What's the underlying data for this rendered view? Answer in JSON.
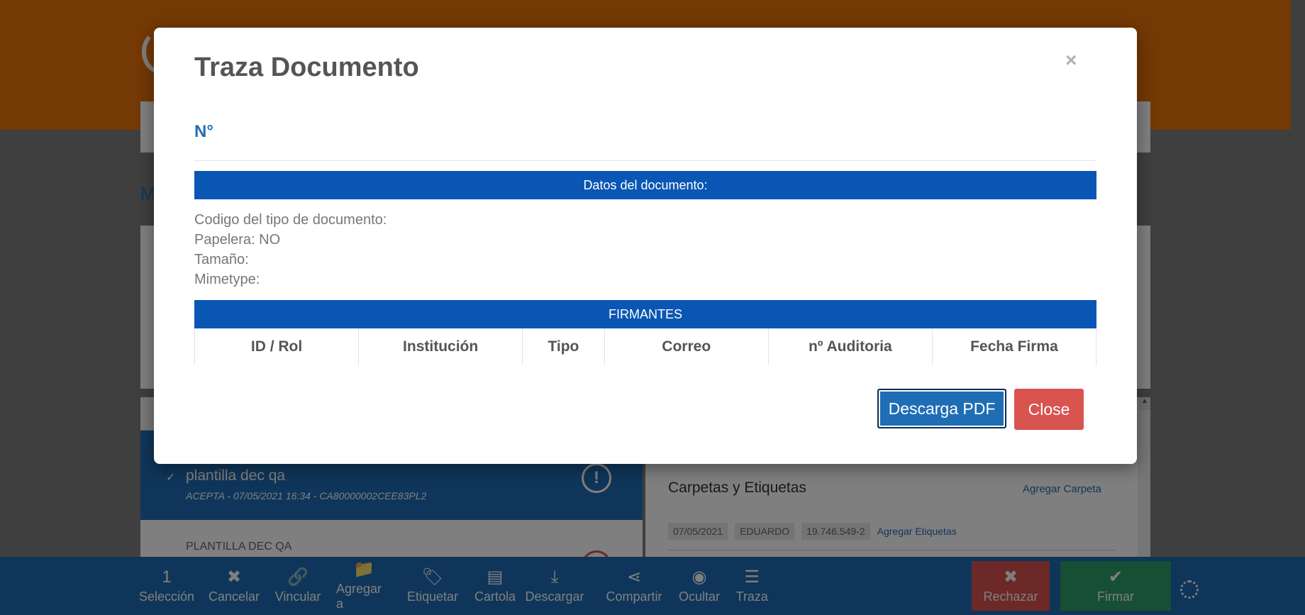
{
  "background": {
    "page_heading": "M",
    "list": {
      "active_item": {
        "check": "✓",
        "title": "plantilla dec qa",
        "subtitle": "ACEPTA - 07/05/2021 16:34 - CA80000002CEE83PL2",
        "status_icon": "!"
      },
      "second_item": {
        "title": "PLANTILLA DEC QA"
      }
    },
    "details": {
      "folders_title": "Carpetas y Etiquetas",
      "add_folder": "Agregar Carpeta",
      "tags": [
        "07/05/2021",
        "EDUARDO",
        "19.746.549-2"
      ],
      "add_tags": "Agregar Etiquetas"
    },
    "toolbar": {
      "selection_count": "1",
      "items": [
        {
          "label": "Selección",
          "icon": "count"
        },
        {
          "label": "Cancelar",
          "icon": "times-icon",
          "glyph": "✖"
        },
        {
          "label": "Vincular",
          "icon": "link-icon",
          "glyph": "🔗"
        },
        {
          "label": "Agregar a",
          "icon": "folder-icon",
          "glyph": "📁"
        },
        {
          "label": "Etiquetar",
          "icon": "tag-icon",
          "glyph": "🏷"
        },
        {
          "label": "Cartola",
          "icon": "list-alt-icon",
          "glyph": "▤"
        },
        {
          "label": "Descargar",
          "icon": "download-icon",
          "glyph": "⤓"
        },
        {
          "label": "Compartir",
          "icon": "share-icon",
          "glyph": "⋖"
        },
        {
          "label": "Ocultar",
          "icon": "eye-slash-icon",
          "glyph": "◉"
        },
        {
          "label": "Traza",
          "icon": "list-icon",
          "glyph": "☰"
        }
      ],
      "reject": {
        "label": "Rechazar",
        "glyph": "✖"
      },
      "sign": {
        "label": "Firmar",
        "glyph": "✔"
      }
    }
  },
  "modal": {
    "title": "Traza Documento",
    "close_glyph": "×",
    "number_label": "N°",
    "document_section": "Datos del documento:",
    "fields": [
      "Codigo del tipo de documento:",
      "Papelera: NO",
      "Tamaño:",
      "Mimetype:"
    ],
    "signers_section": "FIRMANTES",
    "columns": [
      "ID / Rol",
      "Institución",
      "Tipo",
      "Correo",
      "nº Auditoria",
      "Fecha Firma"
    ],
    "buttons": {
      "download_pdf": "Descarga PDF",
      "close": "Close"
    }
  },
  "colors": {
    "header_orange": "#e8730a",
    "primary_blue": "#1f6db5",
    "section_blue": "#0a56b4",
    "danger_red": "#d9534f",
    "success_green": "#2e9e6a"
  }
}
